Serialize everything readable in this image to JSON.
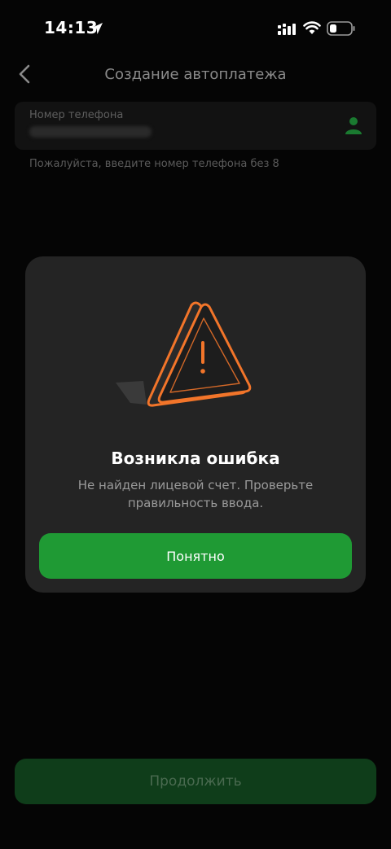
{
  "status_bar": {
    "time": "14:13",
    "icons": [
      "location-arrow-icon",
      "signal-icon",
      "wifi-icon",
      "battery-icon"
    ]
  },
  "header": {
    "title": "Создание автоплатежа",
    "back_icon": "chevron-left-icon"
  },
  "phone_field": {
    "label": "Номер телефона",
    "hint": "Пожалуйста, введите номер телефона без 8",
    "contact_icon": "person-icon"
  },
  "modal": {
    "icon": "warning-triangle-icon",
    "title": "Возникла ошибка",
    "message": "Не найден лицевой счет. Проверьте правильность ввода.",
    "button_label": "Понятно"
  },
  "footer": {
    "continue_label": "Продолжить"
  },
  "colors": {
    "background": "#050505",
    "modal": "#242424",
    "accent_green": "#1f9a34",
    "disabled_green": "#0f3d1a",
    "warning_orange": "#f2752a",
    "contact_icon_green": "#1a7a30"
  }
}
